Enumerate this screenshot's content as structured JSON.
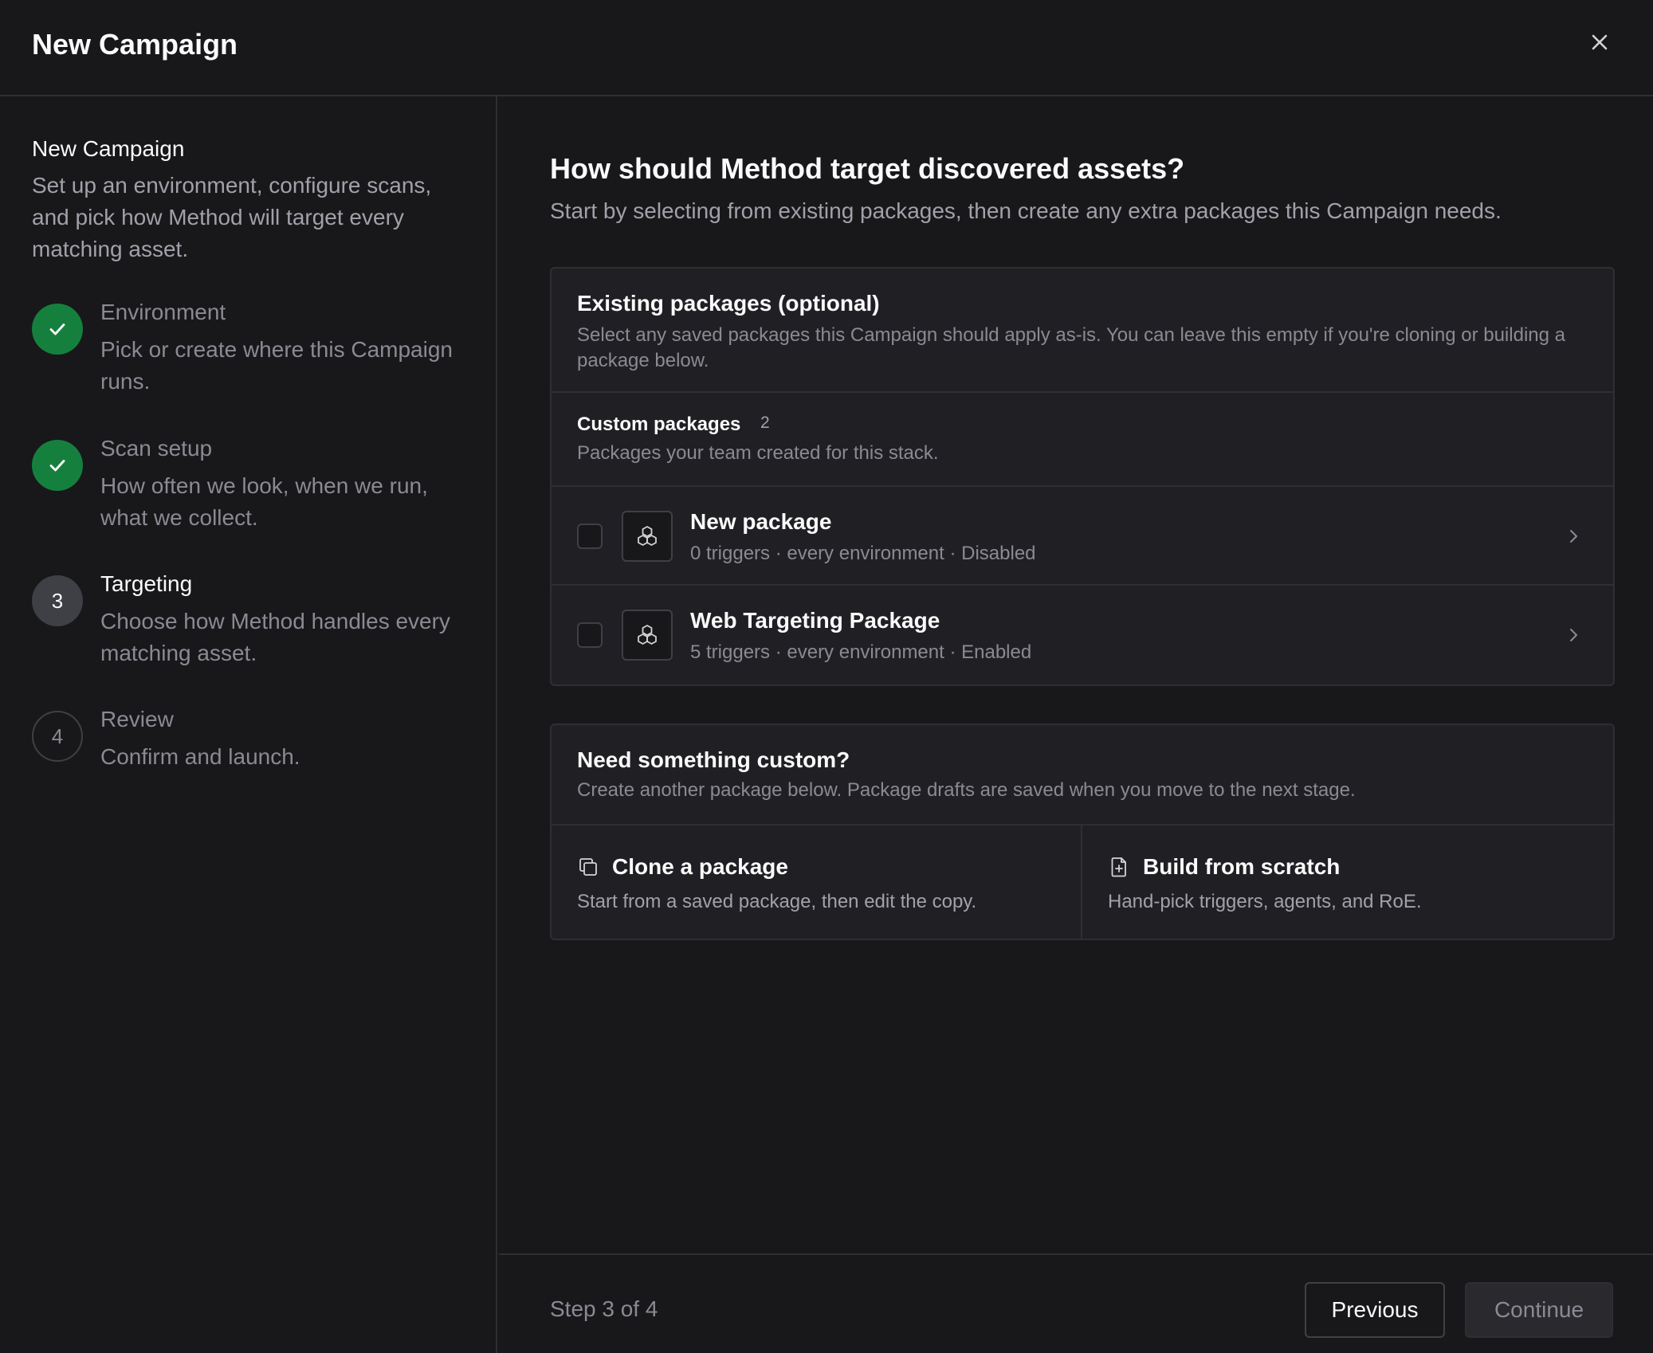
{
  "window": {
    "title": "New Campaign",
    "close_icon": "close-icon"
  },
  "sidebar": {
    "title": "New Campaign",
    "description": "Set up an environment, configure scans, and pick how Method will target every matching asset.",
    "steps": [
      {
        "status": "complete",
        "marker": "check-icon",
        "label": "Environment",
        "description": "Pick or create where this Campaign runs."
      },
      {
        "status": "complete",
        "marker": "check-icon",
        "label": "Scan setup",
        "description": "How often we look, when we run, what we collect."
      },
      {
        "status": "current",
        "number": "3",
        "label": "Targeting",
        "description": "Choose how Method handles every matching asset."
      },
      {
        "status": "upcoming",
        "number": "4",
        "label": "Review",
        "description": "Confirm and launch."
      }
    ]
  },
  "main": {
    "heading": "How should Method target discovered assets?",
    "subheading": "Start by selecting from existing packages, then create any extra packages this Campaign needs.",
    "existing": {
      "title": "Existing packages (optional)",
      "description": "Select any saved packages this Campaign should apply as-is. You can leave this empty if you're cloning or building a package below.",
      "group": {
        "title": "Custom packages",
        "count": "2",
        "description": "Packages your team created for this stack."
      },
      "packages": [
        {
          "name": "New package",
          "meta": "0 triggers · every environment · Disabled",
          "checked": false,
          "icon": "package-icon"
        },
        {
          "name": "Web Targeting Package",
          "meta": "5 triggers · every environment · Enabled",
          "checked": false,
          "icon": "package-icon"
        }
      ]
    },
    "custom": {
      "title": "Need something custom?",
      "description": "Create another package below. Package drafts are saved when you move to the next stage.",
      "options": [
        {
          "title": "Clone a package",
          "description": "Start from a saved package, then edit the copy.",
          "icon": "copy-icon"
        },
        {
          "title": "Build from scratch",
          "description": "Hand-pick triggers, agents, and RoE.",
          "icon": "new-file-icon"
        }
      ]
    }
  },
  "footer": {
    "step_text": "Step 3 of 4",
    "previous_label": "Previous",
    "continue_label": "Continue",
    "continue_disabled": true
  },
  "colors": {
    "background": "#18181b",
    "card": "#202024",
    "border": "#2e2e33",
    "success": "#15803d",
    "muted_text": "#8a8a93"
  }
}
